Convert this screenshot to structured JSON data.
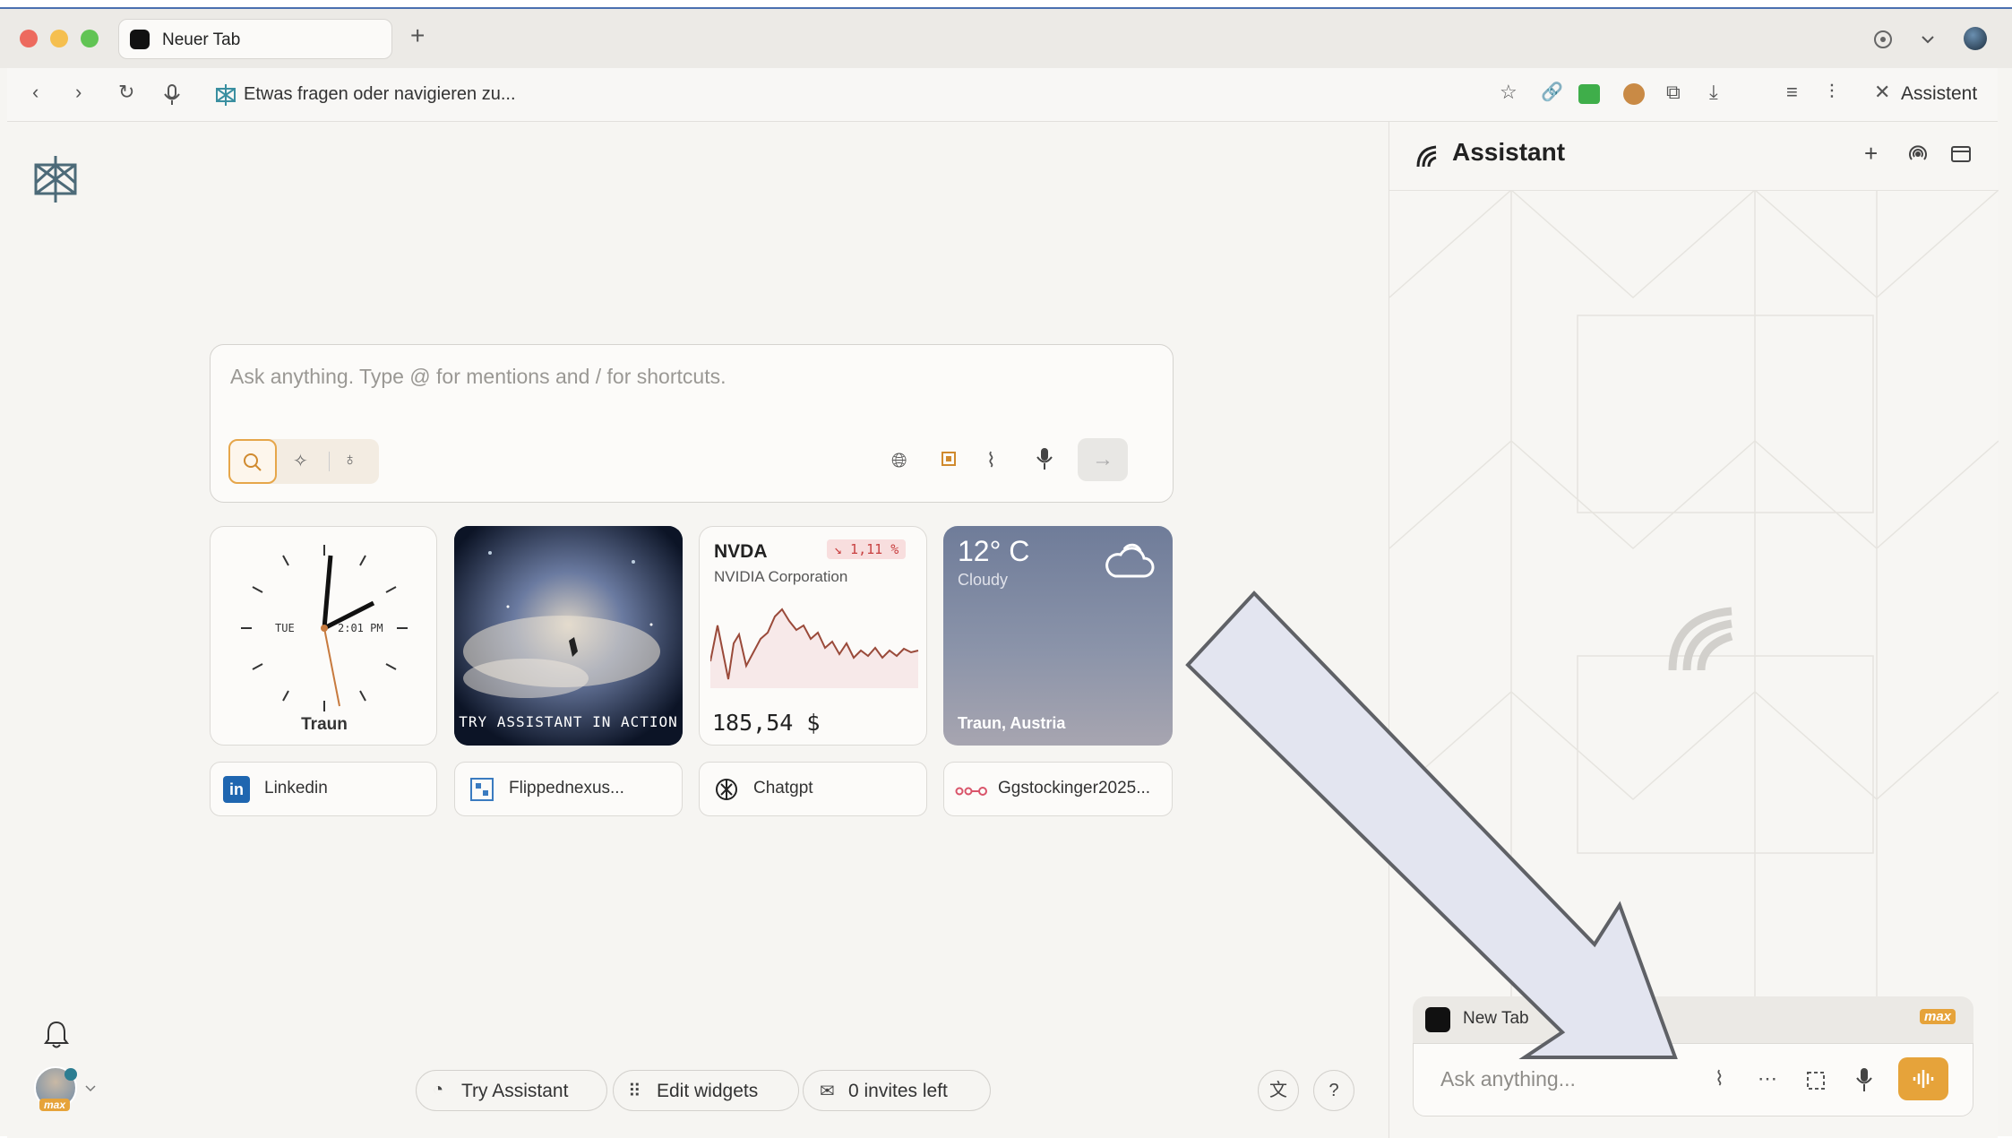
{
  "browser": {
    "tab_title": "Neuer Tab",
    "address_placeholder": "Etwas fragen oder navigieren zu...",
    "assistant_toggle_label": "Assistent"
  },
  "search": {
    "placeholder": "Ask anything. Type @ for mentions and / for shortcuts."
  },
  "widgets": {
    "clock": {
      "day": "TUE",
      "time": "2:01 PM",
      "city": "Traun"
    },
    "promo": {
      "label": "TRY ASSISTANT IN ACTION"
    },
    "stock": {
      "ticker": "NVDA",
      "name": "NVIDIA Corporation",
      "change": "↘ 1,11 %",
      "price": "185,54 $",
      "change_color": "#d9534f"
    },
    "weather": {
      "temp": "12° C",
      "condition": "Cloudy",
      "location": "Traun, Austria"
    }
  },
  "links": [
    {
      "label": "Linkedin",
      "icon": "linkedin-icon"
    },
    {
      "label": "Flippednexus...",
      "icon": "qr-icon"
    },
    {
      "label": "Chatgpt",
      "icon": "openai-icon"
    },
    {
      "label": "Ggstockinger2025...",
      "icon": "link-chain-icon"
    }
  ],
  "footer": {
    "try_assistant": "Try Assistant",
    "edit_widgets": "Edit widgets",
    "invites": "0 invites left",
    "help": "?"
  },
  "assistant": {
    "title": "Assistant",
    "context_tab": "New Tab",
    "badge": "max",
    "input_placeholder": "Ask anything..."
  },
  "profile": {
    "badge": "max"
  },
  "colors": {
    "accent": "#e6a33a",
    "arrow_fill": "#e3e5f0",
    "arrow_stroke": "#5f6166"
  }
}
